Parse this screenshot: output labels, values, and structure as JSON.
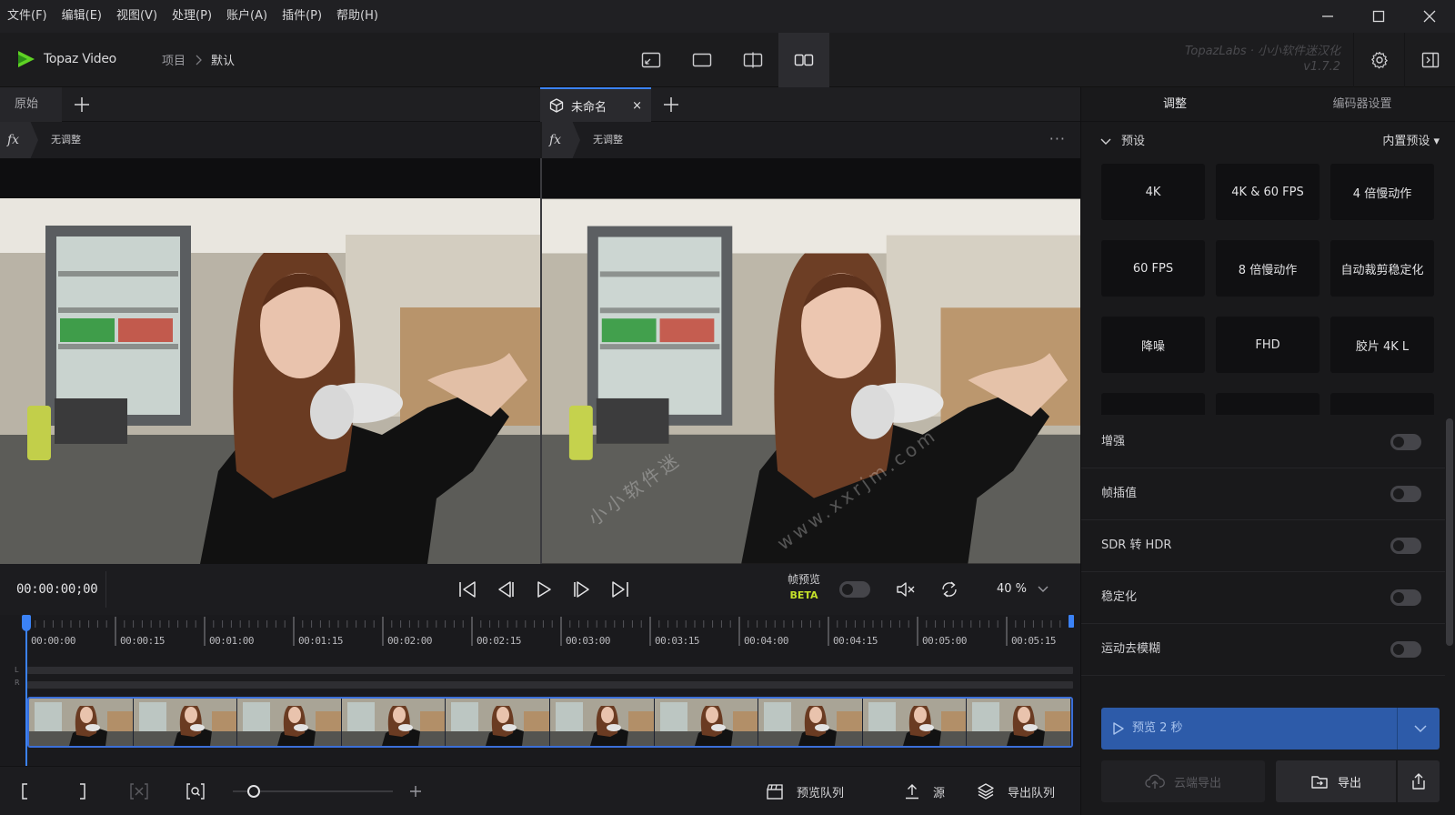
{
  "menu": [
    "文件(F)",
    "编辑(E)",
    "视图(V)",
    "处理(P)",
    "账户(A)",
    "插件(P)",
    "帮助(H)"
  ],
  "app": {
    "name": "Topaz Video",
    "brand_line1": "TopazLabs · 小小软件迷汉化",
    "brand_line2": "v1.7.2"
  },
  "breadcrumb": {
    "project": "项目",
    "current": "默认"
  },
  "left_tab": {
    "label": "原始",
    "fx_label": "无调整"
  },
  "right_tab": {
    "label": "未命名",
    "close": "×",
    "fx_label": "无调整",
    "more": "···"
  },
  "watermark": {
    "text1": "www.xxrjm.com",
    "text2": "小小软件迷"
  },
  "transport": {
    "timecode": "00:00:00;00",
    "frame_preview_label": "帧预览",
    "beta": "BETA",
    "zoom": "40 %"
  },
  "timeline": {
    "labels": [
      "00:00:00",
      "00:00:15",
      "00:01:00",
      "00:01:15",
      "00:02:00",
      "00:02:15",
      "00:03:00",
      "00:03:15",
      "00:04:00",
      "00:04:15",
      "00:05:00",
      "00:05:15"
    ],
    "lr": [
      "L",
      "R"
    ]
  },
  "bottombar": {
    "preview_queue": "预览队列",
    "source": "源",
    "export_queue": "导出队列"
  },
  "right_panel": {
    "tabs": [
      "调整",
      "编码器设置"
    ],
    "preset_title": "预设",
    "preset_builtin": "内置预设 ▾",
    "presets": [
      "4K",
      "4K & 60 FPS",
      "4 倍慢动作",
      "60 FPS",
      "8 倍慢动作",
      "自动裁剪稳定化",
      "降噪",
      "FHD",
      "胶片 4K L",
      "",
      "",
      ""
    ],
    "settings": [
      "增强",
      "帧插值",
      "SDR 转 HDR",
      "稳定化",
      "运动去模糊"
    ],
    "preview_btn": "预览 2 秒",
    "cloud_export": "云端导出",
    "export": "导出"
  },
  "colors": {
    "accent": "#3b82f6",
    "beta": "#c4e02a",
    "preview": "#2d5ba9"
  }
}
